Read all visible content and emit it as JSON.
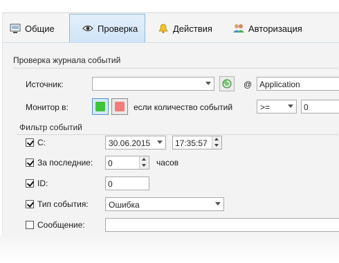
{
  "tabs": [
    {
      "label": "Общие",
      "icon": "monitor-icon"
    },
    {
      "label": "Проверка",
      "icon": "eye-icon",
      "active": true
    },
    {
      "label": "Действия",
      "icon": "bell-icon"
    },
    {
      "label": "Авторизация",
      "icon": "users-icon"
    }
  ],
  "event_log_section": {
    "title": "Проверка журнала событий",
    "source_label": "Источник:",
    "source_value": "",
    "at_label": "@",
    "log_value": "Application",
    "monitor_label": "Монитор в:",
    "condition_label": "если количество событий",
    "operator_value": ">=",
    "count_value": "0",
    "colors": {
      "green": "#3fc43a",
      "red": "#f37b7b"
    }
  },
  "filter_section": {
    "title": "Фильтр событий",
    "since": {
      "label": "С:",
      "checked": true,
      "date": "30.06.2015",
      "time": "17:35:57"
    },
    "last": {
      "label": "За последние:",
      "checked": true,
      "value": "0",
      "unit": "часов"
    },
    "id": {
      "label": "ID:",
      "checked": true,
      "value": "0"
    },
    "event_type": {
      "label": "Тип события:",
      "checked": true,
      "value": "Ошибка"
    },
    "message": {
      "label": "Сообщение:",
      "checked": false,
      "value": ""
    }
  }
}
